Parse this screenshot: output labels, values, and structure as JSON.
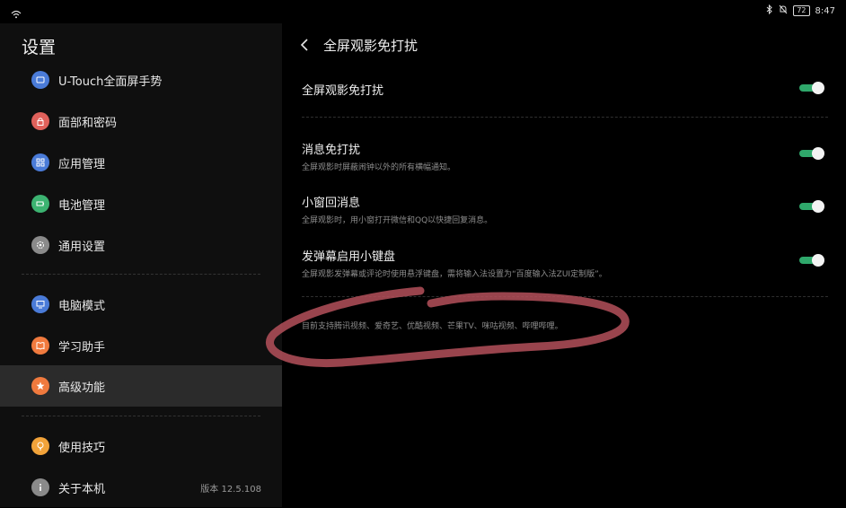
{
  "status_bar": {
    "time": "8:47",
    "battery": "72",
    "icons": [
      "wifi-icon",
      "bluetooth-icon",
      "notification-off-icon",
      "battery-icon"
    ]
  },
  "sidebar": {
    "title": "设置",
    "items": [
      {
        "label": "U-Touch全面屏手势",
        "icon": "gesture-icon",
        "color": "#4a7bd8"
      },
      {
        "label": "面部和密码",
        "icon": "lock-icon",
        "color": "#e0615b"
      },
      {
        "label": "应用管理",
        "icon": "apps-grid-icon",
        "color": "#4a7bd8"
      },
      {
        "label": "电池管理",
        "icon": "battery-icon",
        "color": "#3cb371"
      },
      {
        "label": "通用设置",
        "icon": "gear-icon",
        "color": "#8a8a8a"
      },
      {
        "label": "电脑模式",
        "icon": "monitor-icon",
        "color": "#4a7bd8"
      },
      {
        "label": "学习助手",
        "icon": "book-icon",
        "color": "#f07a3e"
      },
      {
        "label": "高级功能",
        "icon": "star-icon",
        "color": "#f07a3e"
      },
      {
        "label": "使用技巧",
        "icon": "lightbulb-icon",
        "color": "#f2a33a"
      },
      {
        "label": "关于本机",
        "icon": "info-icon",
        "color": "#8a8a8a",
        "meta": "版本 12.5.108"
      }
    ],
    "active_index": 7
  },
  "content": {
    "title": "全屏观影免打扰",
    "settings": [
      {
        "title": "全屏观影免打扰",
        "desc": "",
        "enabled": true
      },
      {
        "title": "消息免打扰",
        "desc": "全屏观影时屏蔽闹钟以外的所有横幅通知。",
        "enabled": true
      },
      {
        "title": "小窗回消息",
        "desc": "全屏观影时，用小窗打开微信和QQ以快捷回复消息。",
        "enabled": true
      },
      {
        "title": "发弹幕启用小键盘",
        "desc": "全屏观影发弹幕或评论时使用悬浮键盘，需将输入法设置为“百度输入法ZUI定制版”。",
        "enabled": true
      }
    ],
    "footnote": "目前支持腾讯视频、爱奇艺、优酷视频、芒果TV、咪咕视频、哔哩哔哩。"
  },
  "colors": {
    "toggle_on": "#2fa86b",
    "annotation_ink": "#b4505a"
  }
}
